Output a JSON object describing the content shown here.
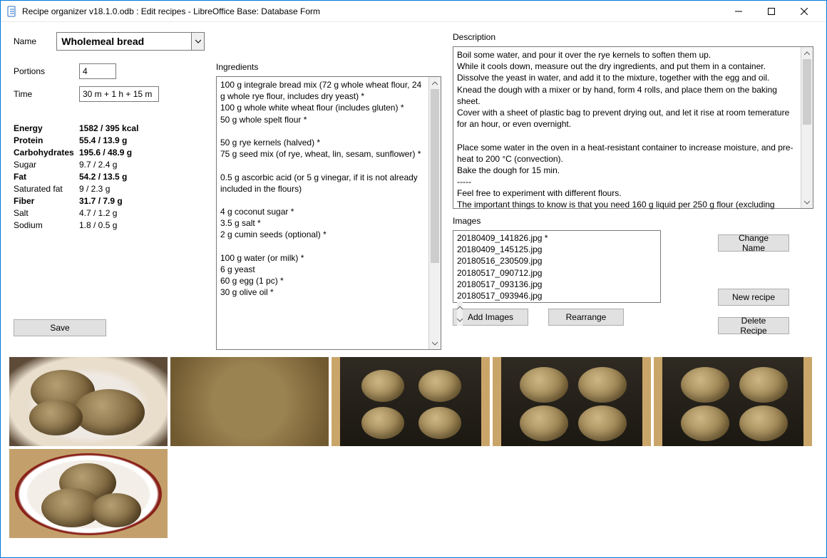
{
  "window": {
    "title": "Recipe organizer v18.1.0.odb : Edit recipes - LibreOffice Base: Database Form"
  },
  "labels": {
    "name": "Name",
    "portions": "Portions",
    "time": "Time",
    "ingredients": "Ingredients",
    "description": "Description",
    "images": "Images"
  },
  "fields": {
    "name": "Wholemeal bread",
    "portions": "4",
    "time": "30 m + 1 h + 15 m"
  },
  "nutrition": [
    {
      "k": "Energy",
      "v": "1582 / 395 kcal",
      "bold": true
    },
    {
      "k": "Protein",
      "v": "55.4 / 13.9 g",
      "bold": true
    },
    {
      "k": "Carbohydrates",
      "v": "195.6 / 48.9 g",
      "bold": true
    },
    {
      "k": "Sugar",
      "v": "9.7 / 2.4 g",
      "bold": false
    },
    {
      "k": "Fat",
      "v": "54.2 / 13.5 g",
      "bold": true
    },
    {
      "k": "Saturated fat",
      "v": "9 / 2.3 g",
      "bold": false
    },
    {
      "k": "Fiber",
      "v": "31.7 / 7.9 g",
      "bold": true
    },
    {
      "k": "Salt",
      "v": "4.7 / 1.2 g",
      "bold": false
    },
    {
      "k": "Sodium",
      "v": "1.8 / 0.5 g",
      "bold": false
    }
  ],
  "ingredients": "100 g integrale bread mix (72 g whole wheat flour, 24 g whole rye flour, includes dry yeast) *\n100 g whole white wheat flour (includes gluten) *\n50 g whole spelt flour *\n\n50 g rye kernels (halved) *\n75 g seed mix (of rye, wheat, lin, sesam, sunflower) *\n\n0.5 g ascorbic acid (or 5 g vinegar, if it is not already included in the flours)\n\n4 g coconut sugar *\n3.5 g salt *\n2 g cumin seeds (optional) *\n\n100 g water (or milk) *\n6 g yeast\n60 g egg (1 pc) *\n30 g olive oil *",
  "description_lines": [
    "Boil some water, and pour it over the rye kernels to soften them up.",
    "While it cools down, measure out the dry ingredients, and put them in a container.",
    "Dissolve the yeast in water, and add it to the mixture, together with the egg and oil.",
    "Knead the dough with a mixer or by hand, form 4 rolls, and place them on the baking sheet.",
    "Cover with a sheet of plastic bag to prevent drying out, and let it rise at room temerature for an hour, or even overnight.",
    "",
    "Place some water in the oven in a heat-resistant container to increase moisture, and pre-heat to 200 °C (convection).",
    "Bake the dough for 15 min.",
    "-----",
    "Feel free to experiment with different flours.",
    "The important things to know is that you need 160 g liquid per 250 g flour (excluding"
  ],
  "image_list": [
    "20180409_141826.jpg *",
    "20180409_145125.jpg",
    "20180516_230509.jpg",
    "20180517_090712.jpg",
    "20180517_093136.jpg",
    "20180517_093946.jpg"
  ],
  "buttons": {
    "save": "Save",
    "add_images": "Add Images",
    "rearrange": "Rearrange",
    "change_name": "Change Name",
    "new_recipe": "New recipe",
    "delete_recipe": "Delete Recipe"
  }
}
